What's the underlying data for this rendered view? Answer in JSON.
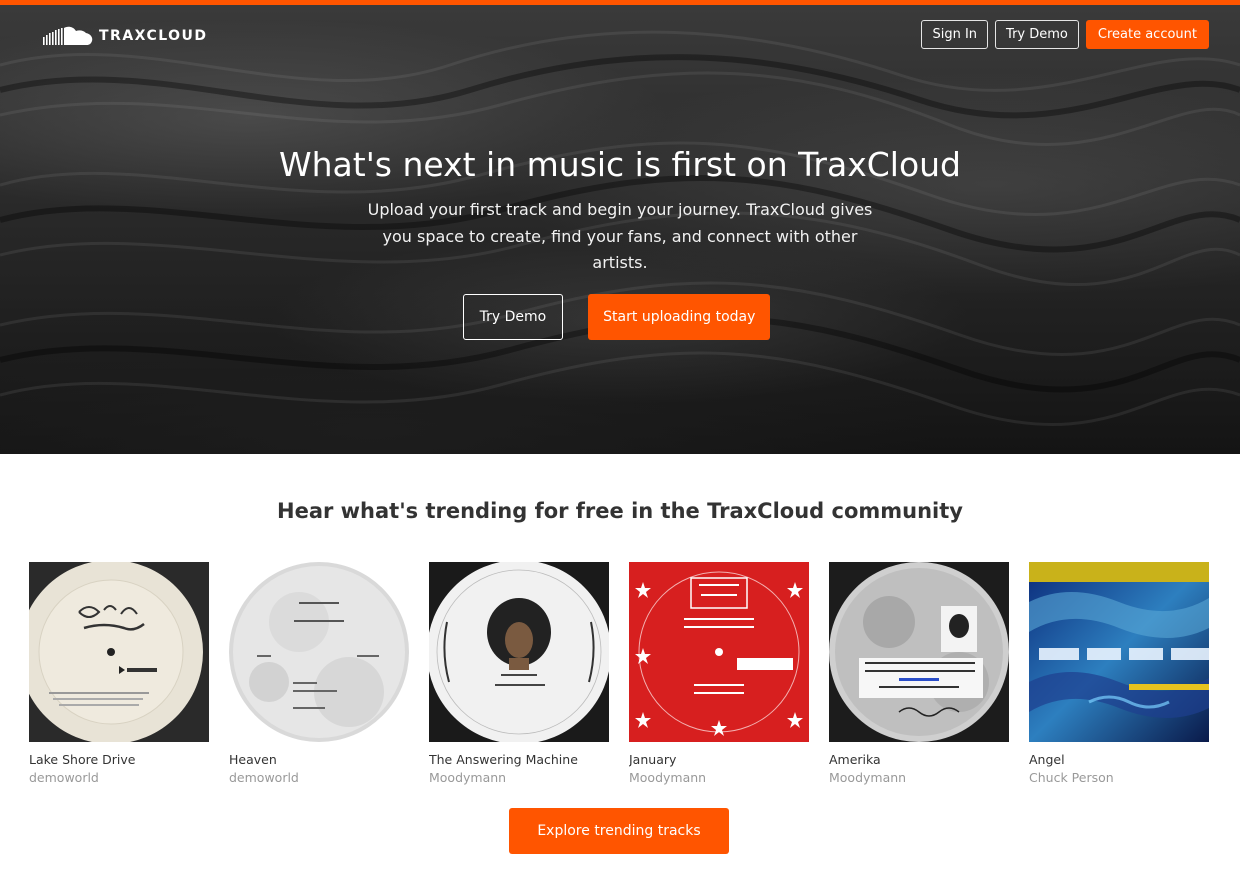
{
  "brand": {
    "name": "TRAXCLOUD",
    "logo_icon": "cloud-waveform-icon",
    "accent": "#ff5500"
  },
  "nav": {
    "sign_in": "Sign In",
    "try_demo": "Try Demo",
    "create_account": "Create account"
  },
  "hero": {
    "title": "What's next in music is first on TraxCloud",
    "subtitle": "Upload your first track and begin your journey. TraxCloud gives you space to create, find your fans, and connect with other artists.",
    "try_demo": "Try Demo",
    "start_uploading": "Start uploading today"
  },
  "trending": {
    "heading": "Hear what's trending for free in the TraxCloud community",
    "tracks": [
      {
        "title": "Lake Shore Drive",
        "artist": "demoworld"
      },
      {
        "title": "Heaven",
        "artist": "demoworld"
      },
      {
        "title": "The Answering Machine",
        "artist": "Moodymann"
      },
      {
        "title": "January",
        "artist": "Moodymann"
      },
      {
        "title": "Amerika",
        "artist": "Moodymann"
      },
      {
        "title": "Angel",
        "artist": "Chuck Person"
      }
    ],
    "explore": "Explore trending tracks"
  }
}
